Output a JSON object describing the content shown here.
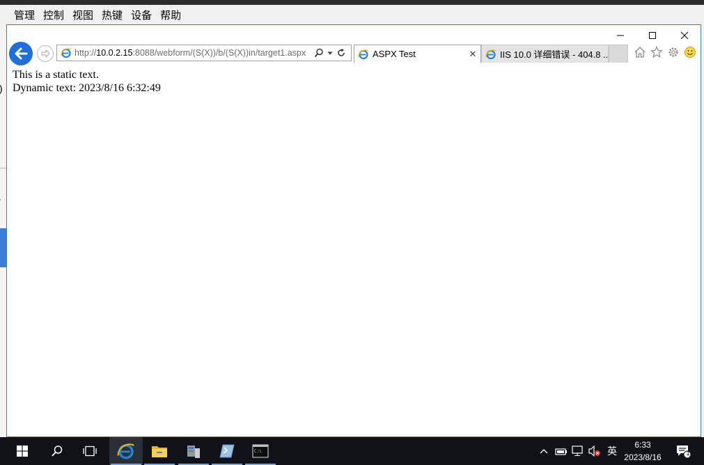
{
  "vm_menu": {
    "items": [
      "管理",
      "控制",
      "视图",
      "热键",
      "设备",
      "帮助"
    ]
  },
  "background_window": {
    "glyph_1": ")",
    "glyph_2": "-"
  },
  "browser": {
    "address": {
      "prefix": "http://",
      "host": "10.0.2.15",
      "rest": ":8088/webform/(S(X))/b/(S(X))in/target1.aspx"
    },
    "tabs": [
      {
        "label": "ASPX Test",
        "active": true
      },
      {
        "label": "IIS 10.0 详细错误 - 404.8 ...",
        "active": false
      }
    ],
    "page": {
      "line1": "This is a static text.",
      "line2": "Dynamic text: 2023/8/16 6:32:49"
    }
  },
  "taskbar": {
    "ime": "英",
    "time": "6:33",
    "date": "2023/8/16",
    "notification_count": "1"
  },
  "colors": {
    "accent_blue": "#1e6fd9",
    "taskbar_bg": "#101218",
    "window_border": "#3c7fb1"
  },
  "icons": [
    "windows-logo-icon",
    "search-icon",
    "task-view-icon",
    "internet-explorer-icon",
    "file-explorer-icon",
    "server-manager-icon",
    "powershell-icon",
    "command-prompt-icon",
    "home-icon",
    "star-icon",
    "gear-icon",
    "smiley-icon"
  ]
}
